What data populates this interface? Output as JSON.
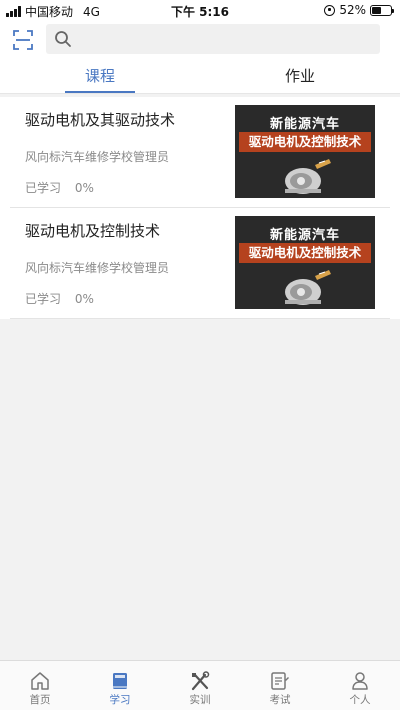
{
  "status_bar": {
    "carrier": "中国移动",
    "network": "4G",
    "time": "下午 5:16",
    "battery": "52%",
    "battery_level": 0.52
  },
  "search": {
    "placeholder": ""
  },
  "tabs": [
    {
      "label": "课程",
      "active": true
    },
    {
      "label": "作业",
      "active": false
    }
  ],
  "courses": [
    {
      "title": "驱动电机及其驱动技术",
      "author": "风向标汽车维修学校管理员",
      "progress_label": "已学习",
      "progress_value": "0%",
      "thumb_line1": "新能源汽车",
      "thumb_line2": "驱动电机及控制技术"
    },
    {
      "title": "驱动电机及控制技术",
      "author": "风向标汽车维修学校管理员",
      "progress_label": "已学习",
      "progress_value": "0%",
      "thumb_line1": "新能源汽车",
      "thumb_line2": "驱动电机及控制技术"
    }
  ],
  "tabbar": [
    {
      "label": "首页",
      "icon": "home-icon",
      "active": false
    },
    {
      "label": "学习",
      "icon": "book-icon",
      "active": true
    },
    {
      "label": "实训",
      "icon": "tools-icon",
      "active": false
    },
    {
      "label": "考试",
      "icon": "exam-icon",
      "active": false
    },
    {
      "label": "个人",
      "icon": "person-icon",
      "active": false
    }
  ],
  "colors": {
    "accent": "#4a78c2",
    "thumb_band": "#b5421e",
    "thumb_bg": "#2a2a2a"
  }
}
